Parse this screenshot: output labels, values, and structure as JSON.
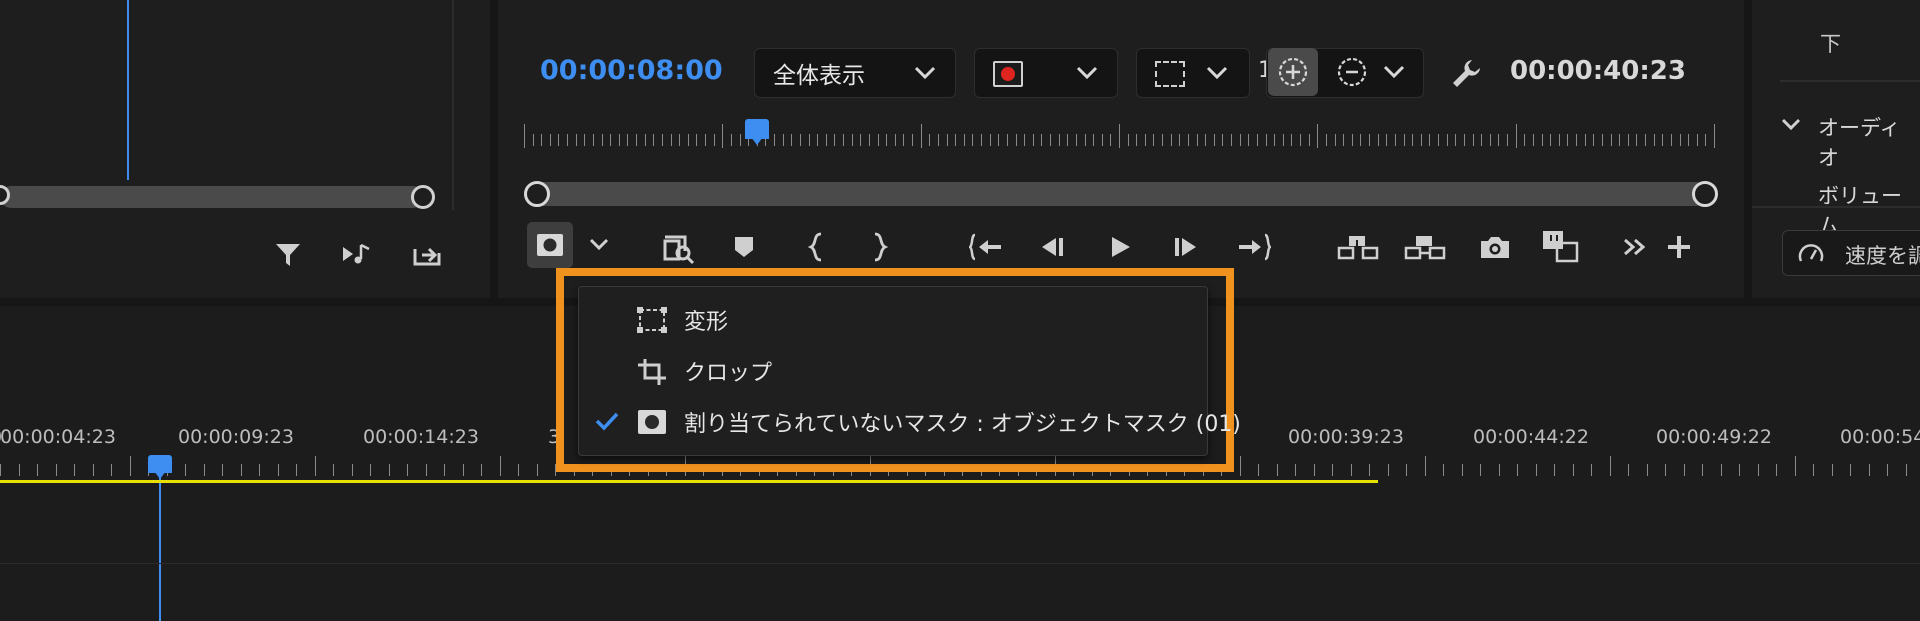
{
  "source_panel": {
    "icons": [
      "filter-icon",
      "insert-audio-icon",
      "export-frame-icon"
    ]
  },
  "program_monitor": {
    "current_timecode": "00:00:08:00",
    "zoom_select": "全体表示",
    "end_timecode": "00:00:40:23",
    "playhead_position": 0.195,
    "clipped_char": "1"
  },
  "right_panel": {
    "item_top": "下",
    "section_audio": "オーディオ",
    "volume_label": "ボリューム",
    "speed_label": "速度を調"
  },
  "mask_menu": {
    "items": [
      {
        "label": "変形",
        "icon": "transform-icon",
        "checked": false
      },
      {
        "label": "クロップ",
        "icon": "crop-icon",
        "checked": false
      },
      {
        "label": "割り当てられていないマスク : オブジェクトマスク (01)",
        "icon": "mask-icon",
        "checked": true
      }
    ]
  },
  "timeline": {
    "labels": [
      "00:00:04:23",
      "00:00:09:23",
      "00:00:14:23",
      "3",
      "00:00:39:23",
      "00:00:44:22",
      "00:00:49:22",
      "00:00:54"
    ],
    "clipped_left": "0"
  },
  "colors": {
    "accent_blue": "#3d8ef0",
    "highlight_orange": "#f0921e",
    "work_area_yellow": "#e8e000",
    "record_red": "#e0241f"
  }
}
